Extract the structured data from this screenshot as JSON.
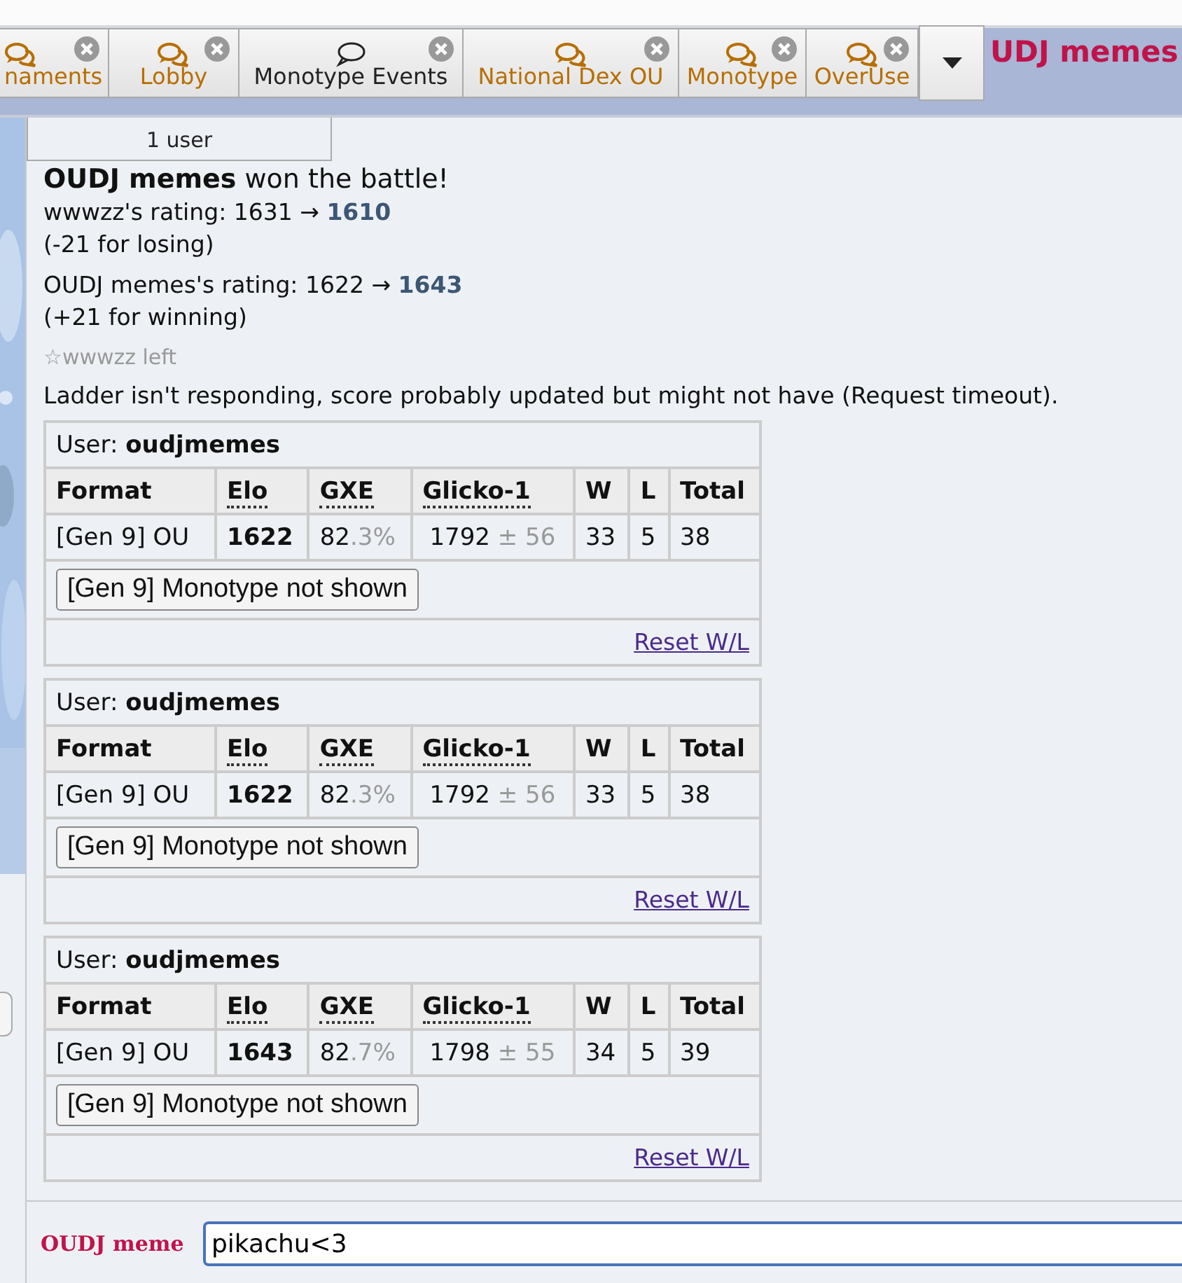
{
  "tabs": [
    {
      "label": "naments",
      "unread": true
    },
    {
      "label": "Lobby",
      "unread": true
    },
    {
      "label": "Monotype Events",
      "unread": false
    },
    {
      "label": "National Dex OU",
      "unread": true
    },
    {
      "label": "Monotype",
      "unread": true
    },
    {
      "label": "OverUse",
      "unread": true
    }
  ],
  "header_user": "UDJ memes",
  "userlist_popup": "1 user",
  "log": [
    {
      "kind": "win",
      "name": "OUDJ memes",
      "text": " won the battle!"
    },
    {
      "kind": "rating",
      "text": "wwwzz's rating: 1631 → ",
      "new": "1610",
      "note": "(-21 for losing)"
    },
    {
      "kind": "rating",
      "text": "OUDJ memes's rating: 1622 → ",
      "new": "1643",
      "note": "(+21 for winning)"
    },
    {
      "kind": "left",
      "text": "☆wwwzz left"
    },
    {
      "kind": "plain",
      "text": "Ladder isn't responding, score probably updated but might not have (Request timeout)."
    }
  ],
  "ladder_tables": [
    {
      "user_label": "User:",
      "user": "oudjmemes",
      "columns": [
        {
          "label": "Format",
          "abbr": false
        },
        {
          "label": "Elo",
          "abbr": true
        },
        {
          "label": "GXE",
          "abbr": true
        },
        {
          "label": "Glicko-1",
          "abbr": true
        },
        {
          "label": "W",
          "abbr": false
        },
        {
          "label": "L",
          "abbr": false
        },
        {
          "label": "Total",
          "abbr": false
        }
      ],
      "row": {
        "format": "[Gen 9] OU",
        "elo": "1622",
        "gxe": "82",
        "gxe_dec": ".3%",
        "glicko": "1792",
        "glicko_dev": " ± 56",
        "w": "33",
        "l": "5",
        "total": "38"
      },
      "button": "[Gen 9] Monotype not shown",
      "link": "Reset W/L"
    },
    {
      "user_label": "User:",
      "user": "oudjmemes",
      "columns": [
        {
          "label": "Format",
          "abbr": false
        },
        {
          "label": "Elo",
          "abbr": true
        },
        {
          "label": "GXE",
          "abbr": true
        },
        {
          "label": "Glicko-1",
          "abbr": true
        },
        {
          "label": "W",
          "abbr": false
        },
        {
          "label": "L",
          "abbr": false
        },
        {
          "label": "Total",
          "abbr": false
        }
      ],
      "row": {
        "format": "[Gen 9] OU",
        "elo": "1622",
        "gxe": "82",
        "gxe_dec": ".3%",
        "glicko": "1792",
        "glicko_dev": " ± 56",
        "w": "33",
        "l": "5",
        "total": "38"
      },
      "button": "[Gen 9] Monotype not shown",
      "link": "Reset W/L"
    },
    {
      "user_label": "User:",
      "user": "oudjmemes",
      "columns": [
        {
          "label": "Format",
          "abbr": false
        },
        {
          "label": "Elo",
          "abbr": true
        },
        {
          "label": "GXE",
          "abbr": true
        },
        {
          "label": "Glicko-1",
          "abbr": true
        },
        {
          "label": "W",
          "abbr": false
        },
        {
          "label": "L",
          "abbr": false
        },
        {
          "label": "Total",
          "abbr": false
        }
      ],
      "row": {
        "format": "[Gen 9] OU",
        "elo": "1643",
        "gxe": "82",
        "gxe_dec": ".7%",
        "glicko": "1798",
        "glicko_dev": " ± 55",
        "w": "34",
        "l": "5",
        "total": "39"
      },
      "button": "[Gen 9] Monotype not shown",
      "link": "Reset W/L"
    }
  ],
  "chat_input": {
    "name": "OUDJ meme",
    "value": "pikachu<3"
  }
}
